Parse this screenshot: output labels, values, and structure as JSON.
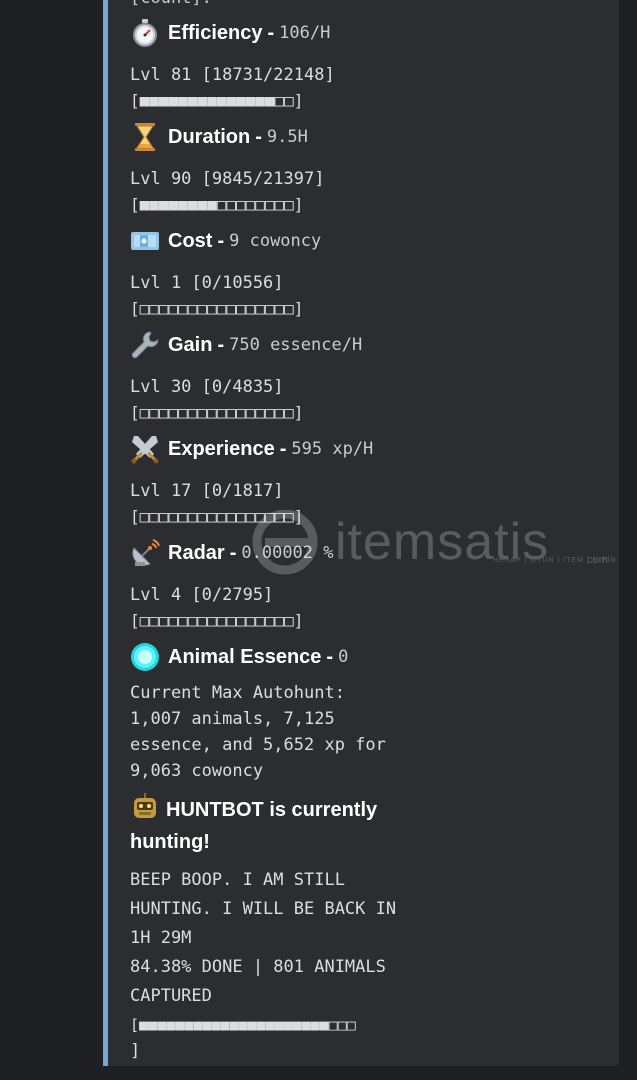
{
  "header_cutoff": "[count].",
  "stats": [
    {
      "key": "efficiency",
      "icon": "stopwatch-icon",
      "name": "Efficiency",
      "value": "106/H",
      "level": "Lvl 81 [18731/22148]",
      "bar": "[■■■■■■■■■■■■■■□□]"
    },
    {
      "key": "duration",
      "icon": "hourglass-icon",
      "name": "Duration",
      "value": "9.5H",
      "level": "Lvl 90 [9845/21397]",
      "bar": "[■■■■■■■■□□□□□□□□]"
    },
    {
      "key": "cost",
      "icon": "cash-icon",
      "name": "Cost",
      "value": "9 cowoncy",
      "level": "Lvl 1 [0/10556]",
      "bar": "[□□□□□□□□□□□□□□□□]"
    },
    {
      "key": "gain",
      "icon": "wrench-icon",
      "name": "Gain",
      "value": "750 essence/H",
      "level": "Lvl 30 [0/4835]",
      "bar": "[□□□□□□□□□□□□□□□□]"
    },
    {
      "key": "experience",
      "icon": "crossed-swords-icon",
      "name": "Experience",
      "value": "595 xp/H",
      "level": "Lvl 17 [0/1817]",
      "bar": "[□□□□□□□□□□□□□□□□]"
    },
    {
      "key": "radar",
      "icon": "satellite-dish-icon",
      "name": "Radar",
      "value": "0.00002 %",
      "level": "Lvl 4 [0/2795]",
      "bar": "[□□□□□□□□□□□□□□□□]"
    }
  ],
  "essence": {
    "icon": "essence-orb-icon",
    "name": "Animal Essence",
    "value": "0",
    "autohunt_lines": [
      "Current Max Autohunt:",
      "1,007 animals, 7,125",
      "essence, and 5,652 xp for",
      "9,063 cowoncy"
    ]
  },
  "huntbot": {
    "icon": "robot-icon",
    "title": "HUNTBOT is currently hunting!",
    "lines": [
      "BEEP BOOP. I AM STILL",
      "HUNTING. I WILL BE BACK IN",
      "1H 29M",
      "84.38% DONE | 801 ANIMALS",
      "CAPTURED",
      "[■■■■■■■■■■■■■■■■■■■■■□□□",
      "]"
    ]
  },
  "watermark": {
    "text": "itemsatis",
    "sub": "HESAP | OYUN | İTEM | E-PİN",
    "com": "com"
  },
  "colors": {
    "embed_bar": "#6ea9d9",
    "embed_bg": "#2b2d31",
    "page_bg": "#1e1f22"
  }
}
